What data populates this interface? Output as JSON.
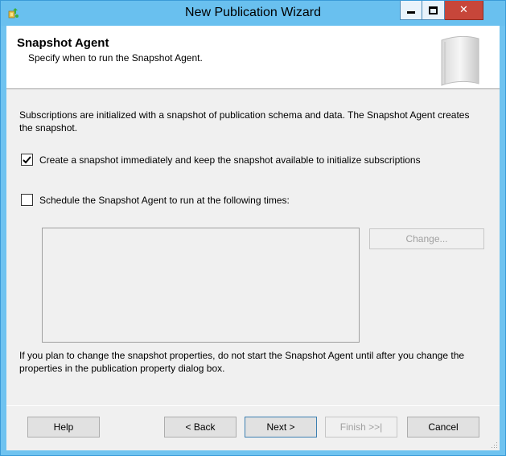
{
  "window": {
    "title": "New Publication Wizard"
  },
  "header": {
    "title": "Snapshot Agent",
    "subtitle": "Specify when to run the Snapshot Agent."
  },
  "intro": "Subscriptions are initialized with a snapshot of publication schema and data. The Snapshot Agent creates the snapshot.",
  "options": {
    "create_snapshot": {
      "label": "Create a snapshot immediately and keep the snapshot available to initialize subscriptions",
      "checked": true
    },
    "schedule_agent": {
      "label": "Schedule the Snapshot Agent to run at the following times:",
      "checked": false
    }
  },
  "schedule": {
    "change_label": "Change..."
  },
  "note": "If you plan to change the snapshot properties, do not start the Snapshot Agent until after you change the properties in the publication property dialog box.",
  "buttons": {
    "help": "Help",
    "back": "< Back",
    "next": "Next >",
    "finish": "Finish >>|",
    "cancel": "Cancel"
  },
  "icons": {
    "app": "app-icon",
    "minimize": "minimize-icon",
    "maximize": "maximize-icon",
    "close": "close-icon",
    "header_art": "book-graphic"
  },
  "colors": {
    "titlebar": "#69c0ef",
    "close_button": "#c7463a",
    "dialog_bg": "#f0f0f0"
  }
}
